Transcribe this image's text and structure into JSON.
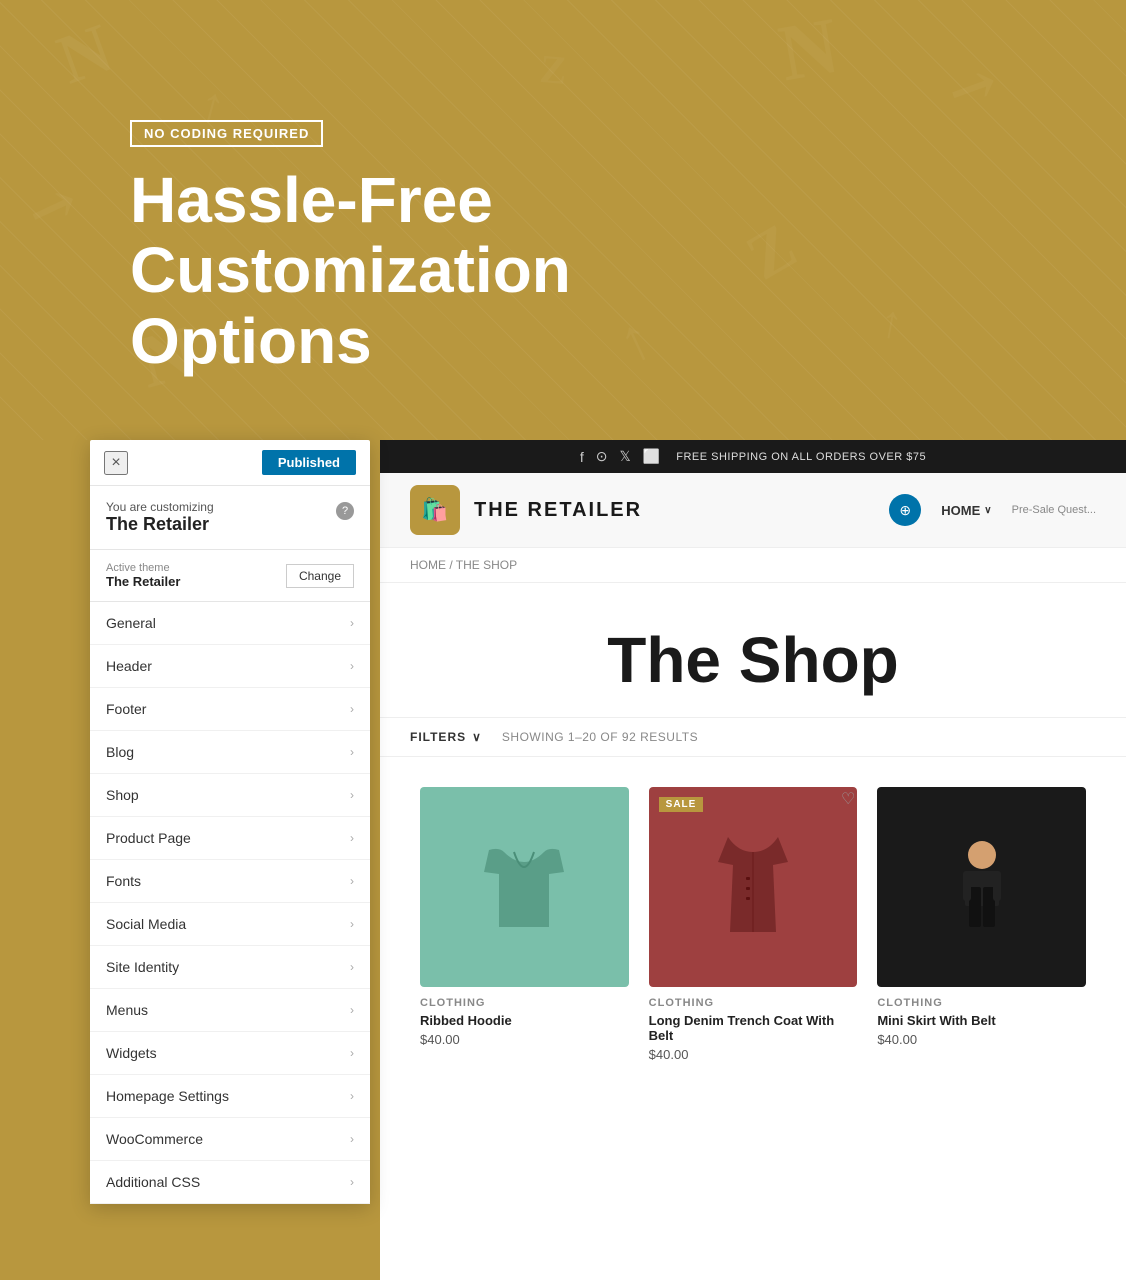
{
  "hero": {
    "badge": "NO CODING REQUIRED",
    "title_line1": "Hassle-Free",
    "title_line2": "Customization Options"
  },
  "customizer": {
    "close_label": "×",
    "published_label": "Published",
    "customizing_prefix": "You are customizing",
    "customizing_name": "The Retailer",
    "help_label": "?",
    "active_theme_label": "Active theme",
    "active_theme_name": "The Retailer",
    "change_label": "Change",
    "menu_items": [
      {
        "label": "General"
      },
      {
        "label": "Header"
      },
      {
        "label": "Footer"
      },
      {
        "label": "Blog"
      },
      {
        "label": "Shop"
      },
      {
        "label": "Product Page"
      },
      {
        "label": "Fonts"
      },
      {
        "label": "Social Media"
      },
      {
        "label": "Site Identity"
      },
      {
        "label": "Menus"
      },
      {
        "label": "Widgets"
      },
      {
        "label": "Homepage Settings"
      },
      {
        "label": "WooCommerce"
      },
      {
        "label": "Additional CSS"
      }
    ]
  },
  "store": {
    "topbar": {
      "shipping_text": "FREE SHIPPING ON ALL ORDERS OVER $75"
    },
    "nav": {
      "logo_text": "THE RETAILER",
      "home_link": "HOME",
      "presale_text": "Pre-Sale Quest..."
    },
    "breadcrumb": "HOME / THE SHOP",
    "shop_title": "The Shop",
    "filters_label": "FILTERS",
    "results_text": "SHOWING 1–20 OF 92 RESULTS",
    "products": [
      {
        "category": "CLOTHING",
        "name": "Ribbed Hoodie",
        "price": "$40.00",
        "sale": false,
        "color": "#7abfaa",
        "emoji": "👘"
      },
      {
        "category": "CLOTHING",
        "name": "Long Denim Trench Coat With Belt",
        "price": "$40.00",
        "sale": true,
        "color": "#9e4040",
        "emoji": "🧥"
      },
      {
        "category": "CLOTHING",
        "name": "Mini Skirt With Belt",
        "price": "$40.00",
        "sale": false,
        "color": "#1a1a1a",
        "emoji": "👗"
      }
    ]
  }
}
